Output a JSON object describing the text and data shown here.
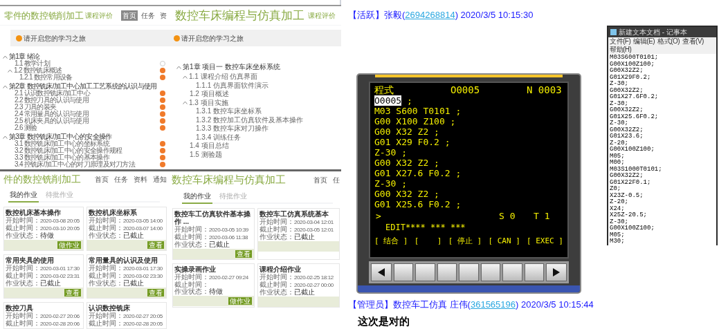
{
  "panels": [
    {
      "kind": "outline",
      "title": "零件的数控铣削加工",
      "rating": "课程评价",
      "nav": [
        {
          "label": "首页",
          "selected": true
        },
        {
          "label": "任务",
          "selected": false
        },
        {
          "label": "资",
          "selected": false
        }
      ],
      "banner": "请开启您的学习之旅",
      "tree": [
        {
          "label": "第1章 绪论",
          "expanded": true,
          "children": [
            {
              "label": "1.1 教学计划",
              "done": false
            },
            {
              "label": "1.2 数控铣床概述",
              "expanded": true,
              "done": true,
              "children": [
                {
                  "label": "1.2.1 数控常用设备",
                  "done": true
                }
              ]
            }
          ]
        },
        {
          "label": "第2章 数控铣床/加工中心加工工艺系统的认识与使用",
          "expanded": true,
          "children": [
            {
              "label": "2.1 认识数控铣床/加工中心",
              "done": true
            },
            {
              "label": "2.2 数控刀具的认识与使用",
              "done": true
            },
            {
              "label": "2.3 刀具的装夹",
              "done": true
            },
            {
              "label": "2.4 常用量具的认识与使用",
              "done": true
            },
            {
              "label": "2.5 机床夹具的认识与使用",
              "done": true
            },
            {
              "label": "2.6 测验",
              "done": true
            }
          ]
        },
        {
          "label": "第3章 数控铣床/加工中心的安全操作",
          "expanded": true,
          "children": [
            {
              "label": "3.1 数控铣床/加工中心的坐标系统",
              "done": true
            },
            {
              "label": "3.2 数控铣床/加工中心的安全操作规程",
              "done": true
            },
            {
              "label": "3.3 数控铣床/加工中心的基本操作",
              "done": true
            },
            {
              "label": "3.4 控铣床/加工中心的对刀原理及对刀方法",
              "done": true
            }
          ]
        }
      ]
    },
    {
      "kind": "outline",
      "title": "数控车床编程与仿真加工",
      "rating": "课程评价",
      "banner": "请开启您的学习之旅",
      "tree": [
        {
          "label": "第1章 项目一 数控车床坐标系统",
          "expanded": true,
          "children": [
            {
              "label": "1.1 课程介绍 仿真界面",
              "expanded": true,
              "children": [
                {
                  "label": "1.1.1 仿真界面软件演示"
                }
              ]
            },
            {
              "label": "1.2 项目概述"
            },
            {
              "label": "1.3 项目实施",
              "expanded": true,
              "children": [
                {
                  "label": "1.3.1 数控车床坐标系"
                },
                {
                  "label": "1.3.2 数控加工仿真软件及基本操作"
                },
                {
                  "label": "1.3.3 数控车床对刀操作"
                },
                {
                  "label": "1.3.4 训练任务"
                }
              ]
            },
            {
              "label": "1.4 项目总结"
            },
            {
              "label": "1.5 测验题"
            }
          ]
        }
      ]
    },
    {
      "kind": "assignments",
      "title": "件的数控铣削加工",
      "nav": [
        "首页",
        "任务",
        "资料",
        "通知"
      ],
      "tabs": [
        {
          "label": "我的作业",
          "selected": true
        },
        {
          "label": "待批作业",
          "selected": false
        }
      ],
      "cards": [
        {
          "title": "数控机床基本操作",
          "lines": [
            {
              "label": "开始时间：",
              "value": "2020-03-08 20:05"
            },
            {
              "label": "截止时间：",
              "value": "2020-03-10 20:05"
            },
            {
              "label": "作业状态：",
              "value": "待做"
            }
          ],
          "button": "做作业"
        },
        {
          "title": "数控机床坐标系",
          "lines": [
            {
              "label": "开始时间：",
              "value": "2020-03-05 14:00"
            },
            {
              "label": "截止时间：",
              "value": "2020-03-07 14:00"
            },
            {
              "label": "作业状态：",
              "value": "已截止"
            }
          ],
          "button": "查看"
        },
        {
          "title": "常用夹具的使用",
          "lines": [
            {
              "label": "开始时间：",
              "value": "2020-03-01 17:30"
            },
            {
              "label": "截止时间：",
              "value": "2020-03-02 23:31"
            },
            {
              "label": "作业状态：",
              "value": "已截止"
            }
          ],
          "button": "查看"
        },
        {
          "title": "常用量具的认识及使用",
          "lines": [
            {
              "label": "开始时间：",
              "value": "2020-03-01 17:30"
            },
            {
              "label": "截止时间：",
              "value": "2020-03-02 23:30"
            },
            {
              "label": "作业状态：",
              "value": "已截止"
            }
          ],
          "button": "查看"
        },
        {
          "title": "数控刀具",
          "lines": [
            {
              "label": "开始时间：",
              "value": "2020-02-27 20:06"
            },
            {
              "label": "截止时间：",
              "value": "2020-02-28 20:06"
            }
          ]
        },
        {
          "title": "认识数控铣床",
          "lines": [
            {
              "label": "开始时间：",
              "value": "2020-02-27 20:05"
            },
            {
              "label": "截止时间：",
              "value": "2020-02-28 20:05"
            }
          ]
        }
      ]
    },
    {
      "kind": "assignments",
      "title": "数控车床编程与仿真加工",
      "nav": [
        "首页",
        "任"
      ],
      "tabs": [
        {
          "label": "我的作业",
          "selected": true
        },
        {
          "label": "待批作业",
          "selected": false
        }
      ],
      "cards": [
        {
          "title": "数控车工仿真软件基本操作 ...",
          "lines": [
            {
              "label": "开始时间：",
              "value": "2020-03-05 10:39"
            },
            {
              "label": "截止时间：",
              "value": "2020-03-06 11:38"
            },
            {
              "label": "作业状态：",
              "value": "已截止"
            }
          ],
          "button": "查看"
        },
        {
          "title": "数控车工仿真系统基本",
          "lines": [
            {
              "label": "开始时间：",
              "value": "2020-03-04 12:01"
            },
            {
              "label": "截止时间：",
              "value": "2020-03-05 12:01"
            },
            {
              "label": "作业状态：",
              "value": "已截止"
            }
          ]
        },
        {
          "title": "实操录画作业",
          "lines": [
            {
              "label": "开始时间：",
              "value": "2020-02-27 09:24"
            },
            {
              "label": "截止时间："
            },
            {
              "label": "作业状态：",
              "value": "待做"
            }
          ],
          "button": "做作业"
        },
        {
          "title": "课程介绍作业",
          "lines": [
            {
              "label": "开始时间：",
              "value": "2020-02-25 18:12"
            },
            {
              "label": "截止时间：",
              "value": "2020-02-27 00:00"
            },
            {
              "label": "作业状态：",
              "value": "已截止"
            }
          ]
        }
      ]
    }
  ],
  "chat": [
    {
      "prefix": "【活跃】张毅(",
      "qq": "2694268814",
      "suffix": ") 2020/3/5 10:15:30"
    },
    {
      "prefix": "【管理员】数控车工仿真 庄伟(",
      "qq": "361565196",
      "suffix": ") 2020/3/5 10:15:44"
    }
  ],
  "message": "这次是对的",
  "cnc": {
    "header": [
      "程式",
      "O0005",
      "N 0003"
    ],
    "lines": [
      {
        "cursor": "O0005",
        "text": " ;"
      },
      {
        "text": "M03 S600 T0101 ;"
      },
      {
        "text": "G00 X100 Z100 ;"
      },
      {
        "text": "G00 X32 Z2 ;"
      },
      {
        "text": "G01 X29 F0.2 ;"
      },
      {
        "text": "Z-30 ;"
      },
      {
        "text": "G00 X32 Z2 ;"
      },
      {
        "text": "G01 X27.6 F0.2 ;"
      },
      {
        "text": "Z-30 ;"
      },
      {
        "text": "G00 X32 Z2 ;"
      },
      {
        "text": "G01 X25.6 F0.2 ;"
      }
    ],
    "status": [
      ">",
      "S 0",
      "T 1"
    ],
    "mode": "EDIT**** *** ***",
    "softkeys": [
      "[ 结合 ]",
      "[    ]",
      "[ 停止 ]",
      "[ CAN ]",
      "[ EXEC ]"
    ]
  },
  "notepad": {
    "title": "新建文本文档 - 记事本",
    "menu": [
      "文件(F)",
      "编辑(E)",
      "格式(O)",
      "查看(V)",
      "帮助(H)"
    ],
    "lines": [
      "M03S600T0101;",
      "G00X100Z100;",
      "G00X32Z2;",
      "G01X29F0.2;",
      "Z-30;",
      "G00X32Z2;",
      "G01X27.6F0.2;",
      "Z-30;",
      "G00X32Z2;",
      "G01X25.6F0.2;",
      "Z-30;",
      "G00X32Z2;",
      "G01X23.6;",
      "Z-20;",
      "G00X100Z100;",
      "M05;",
      "M00;",
      "M03S1000T0101;",
      "G00X32Z2;",
      "G01X22F0.1;",
      "Z0;",
      "X23Z-0.5;",
      "Z-20;",
      "X24;",
      "X25Z-20.5;",
      "Z-30;",
      "G00X100Z100;",
      "M05;",
      "M30;"
    ]
  }
}
